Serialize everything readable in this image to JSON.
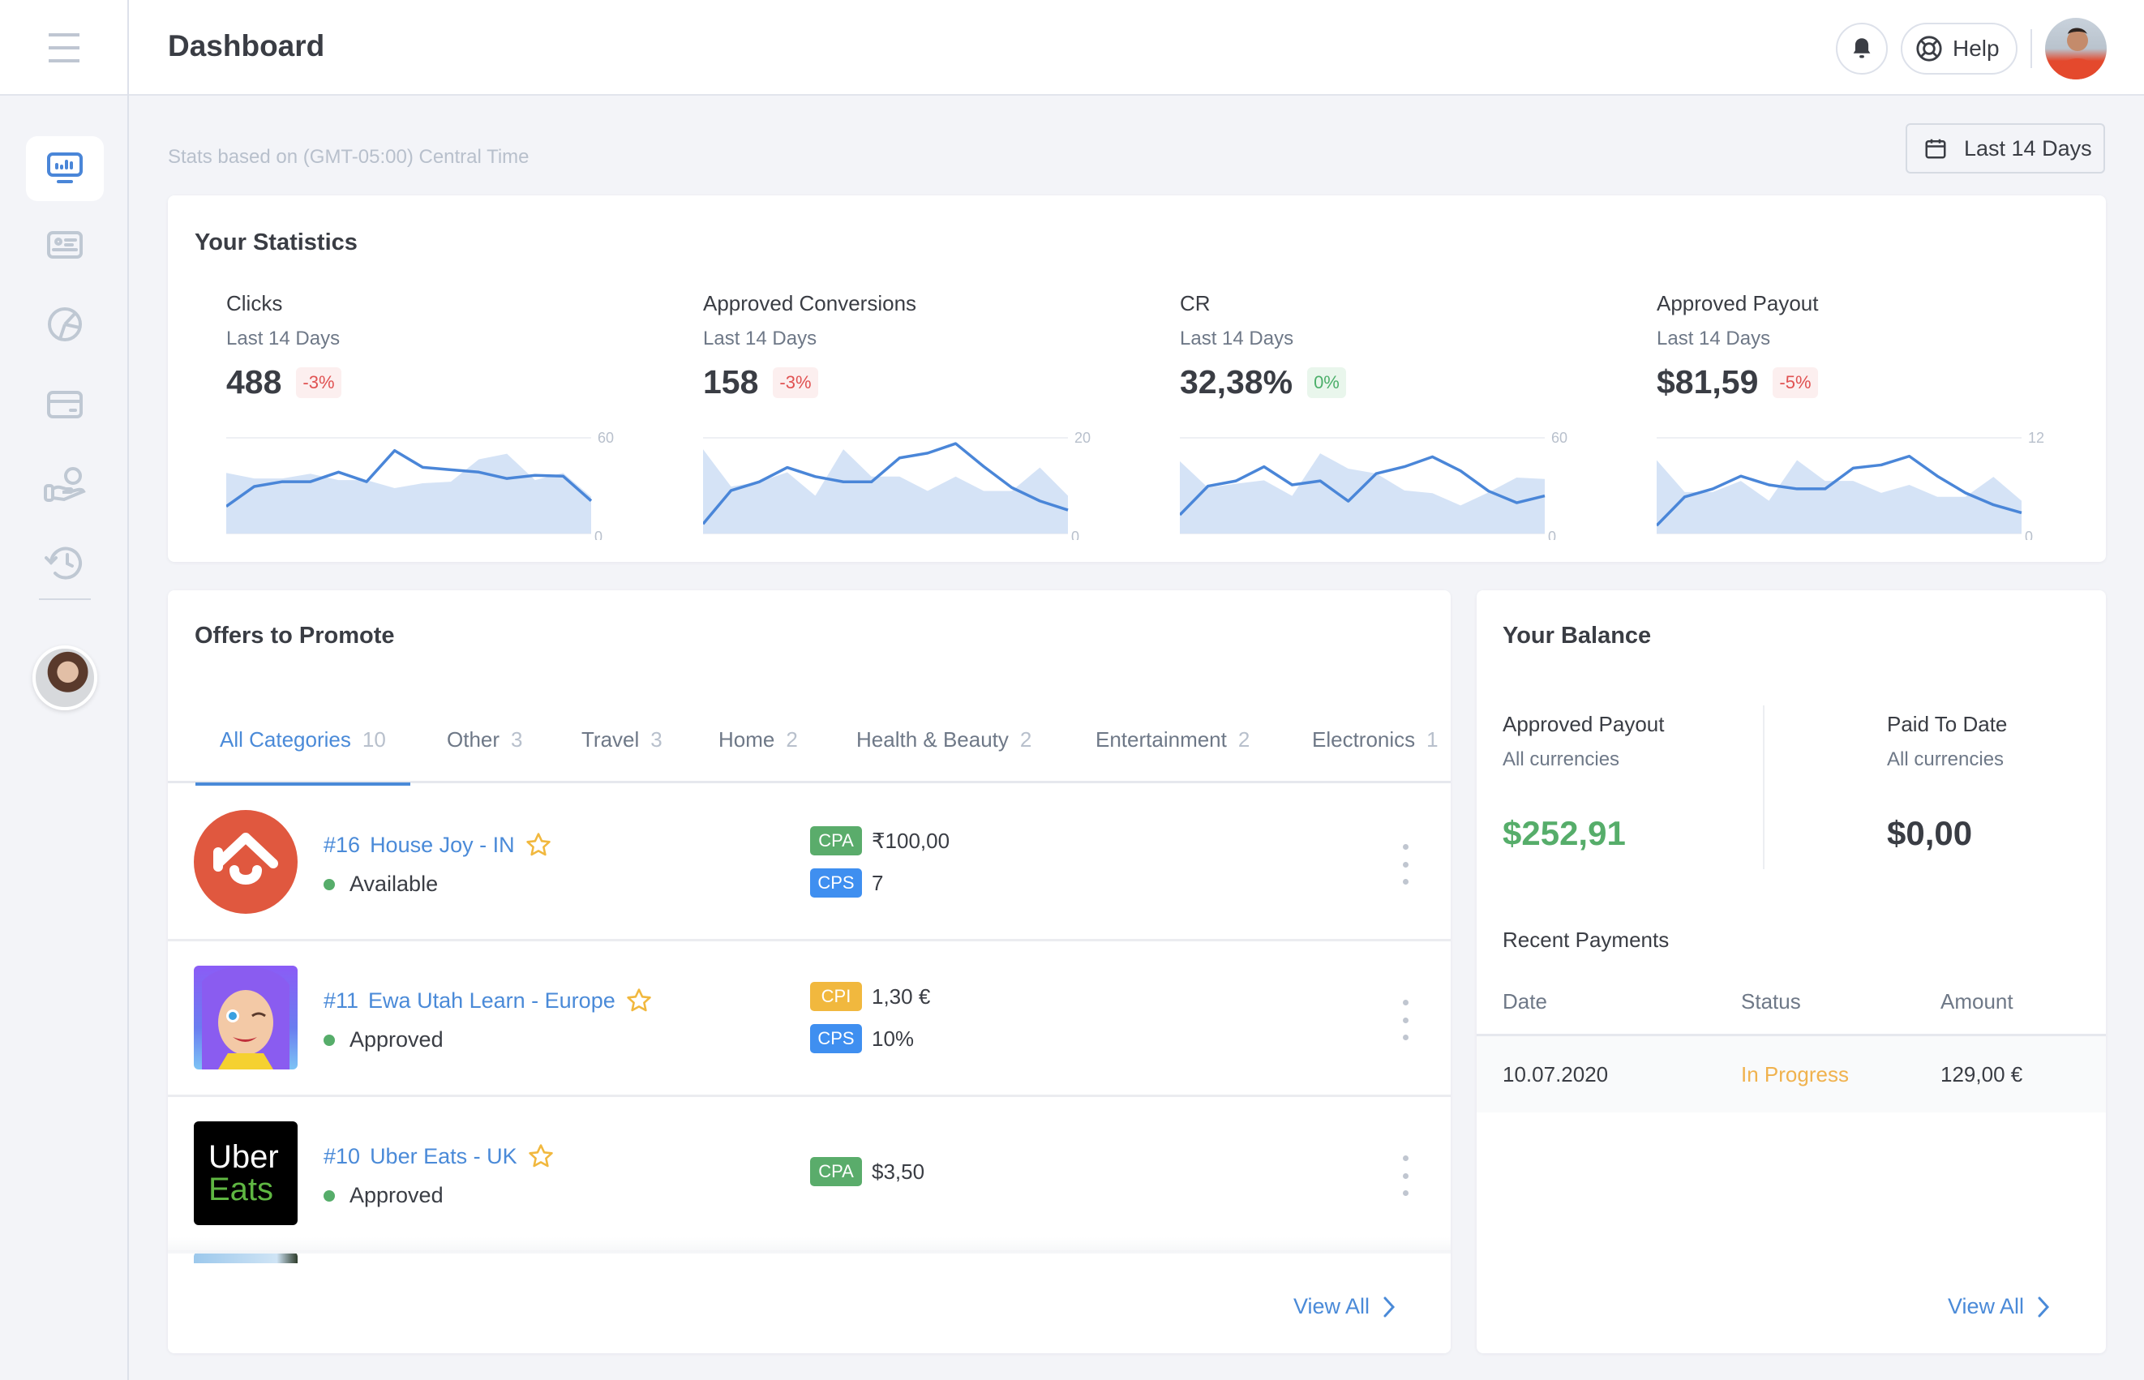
{
  "header": {
    "title": "Dashboard",
    "help_label": "Help"
  },
  "sidebar": {
    "items": [
      {
        "icon": "dashboard-monitor-icon",
        "active": true
      },
      {
        "icon": "id-card-icon",
        "active": false
      },
      {
        "icon": "pie-chart-icon",
        "active": false
      },
      {
        "icon": "credit-card-icon",
        "active": false
      },
      {
        "icon": "hand-coin-icon",
        "active": false
      },
      {
        "icon": "history-icon",
        "active": false
      }
    ]
  },
  "toolbar": {
    "timezone_note": "Stats based on (GMT-05:00) Central Time",
    "date_range": "Last 14 Days"
  },
  "statistics": {
    "title": "Your Statistics",
    "items": [
      {
        "label": "Clicks",
        "period": "Last 14 Days",
        "value": "488",
        "delta": "-3%",
        "delta_type": "neg"
      },
      {
        "label": "Approved Conversions",
        "period": "Last 14 Days",
        "value": "158",
        "delta": "-3%",
        "delta_type": "neg"
      },
      {
        "label": "CR",
        "period": "Last 14 Days",
        "value": "32,38%",
        "delta": "0%",
        "delta_type": "zero"
      },
      {
        "label": "Approved Payout",
        "period": "Last 14 Days",
        "value": "$81,59",
        "delta": "-5%",
        "delta_type": "neg"
      }
    ]
  },
  "chart_data": [
    {
      "type": "line",
      "title": "Clicks",
      "ylim": [
        0,
        60
      ],
      "ytick_labels": [
        "60",
        "0"
      ],
      "series": [
        {
          "name": "current",
          "style": "line",
          "color": "#4a86d8",
          "values": [
            17,
            29.5,
            32.5,
            32.5,
            38.5,
            32.5,
            52,
            41.5,
            40,
            38.5,
            34.5,
            36.5,
            36,
            20.5
          ]
        },
        {
          "name": "previous",
          "style": "area",
          "color": "#d5e3f6",
          "values": [
            38,
            34.5,
            34.5,
            37.5,
            33.5,
            33.5,
            28.5,
            31.5,
            32.5,
            46.5,
            50,
            33.5,
            38,
            23
          ]
        }
      ]
    },
    {
      "type": "line",
      "title": "Approved Conversions",
      "ylim": [
        0,
        20
      ],
      "ytick_labels": [
        "20",
        "0"
      ],
      "series": [
        {
          "name": "current",
          "style": "line",
          "color": "#4a86d8",
          "values": [
            2,
            9,
            10.8,
            13.8,
            11.9,
            10.8,
            10.8,
            15.8,
            16.8,
            18.8,
            14,
            9.6,
            6.8,
            4.9
          ]
        },
        {
          "name": "previous",
          "style": "area",
          "color": "#d5e3f6",
          "values": [
            17.6,
            9.8,
            10.8,
            12.8,
            7.9,
            17.6,
            11.9,
            11.9,
            8.9,
            11.9,
            8.9,
            8.9,
            13.8,
            7.9
          ]
        }
      ]
    },
    {
      "type": "line",
      "title": "CR",
      "ylim": [
        0,
        60
      ],
      "ytick_labels": [
        "60",
        "0"
      ],
      "series": [
        {
          "name": "current",
          "style": "line",
          "color": "#4a86d8",
          "values": [
            11.7,
            29.7,
            33,
            41.9,
            30.5,
            33,
            20.3,
            37.6,
            41.9,
            48.1,
            39.3,
            26.6,
            19.3,
            23.6
          ]
        },
        {
          "name": "previous",
          "style": "area",
          "color": "#d5e3f6",
          "values": [
            45.3,
            28.8,
            31.2,
            33.4,
            23.6,
            50.3,
            40.7,
            37.6,
            27,
            25.3,
            17.6,
            25.8,
            35.1,
            34.2
          ]
        }
      ]
    },
    {
      "type": "line",
      "title": "Approved Payout",
      "ylim": [
        0,
        12
      ],
      "ytick_labels": [
        "12",
        "0"
      ],
      "series": [
        {
          "name": "current",
          "style": "line",
          "color": "#4a86d8",
          "values": [
            1,
            4.6,
            5.6,
            7.2,
            6.1,
            5.6,
            5.6,
            8.2,
            8.6,
            9.7,
            7.2,
            5.1,
            3.6,
            2.6
          ]
        },
        {
          "name": "previous",
          "style": "area",
          "color": "#d5e3f6",
          "values": [
            9.2,
            5.2,
            5.2,
            6.6,
            4.1,
            9.2,
            6.6,
            6.6,
            5.1,
            6.1,
            4.6,
            4.6,
            7.1,
            4.1
          ]
        }
      ]
    }
  ],
  "offers": {
    "title": "Offers to Promote",
    "tabs": [
      {
        "label": "All Categories",
        "count": "10",
        "active": true
      },
      {
        "label": "Other",
        "count": "3"
      },
      {
        "label": "Travel",
        "count": "3"
      },
      {
        "label": "Home",
        "count": "2"
      },
      {
        "label": "Health & Beauty",
        "count": "2"
      },
      {
        "label": "Entertainment",
        "count": "2"
      },
      {
        "label": "Electronics",
        "count": "1"
      }
    ],
    "rows": [
      {
        "id": "#16",
        "name": "House Joy - IN",
        "status": "Available",
        "logo": "house-joy-logo",
        "payouts": [
          {
            "type": "CPA",
            "value": "₹100,00"
          },
          {
            "type": "CPS",
            "value": "7"
          }
        ]
      },
      {
        "id": "#11",
        "name": "Ewa Utah Learn - Europe",
        "status": "Approved",
        "logo": "ewa-logo",
        "payouts": [
          {
            "type": "CPI",
            "value": "1,30 €"
          },
          {
            "type": "CPS",
            "value": "10%"
          }
        ]
      },
      {
        "id": "#10",
        "name": "Uber Eats - UK",
        "status": "Approved",
        "logo": "uber-eats-logo",
        "logo_text": [
          "Uber",
          "Eats"
        ],
        "payouts": [
          {
            "type": "CPA",
            "value": "$3,50"
          }
        ]
      }
    ],
    "view_all": "View All"
  },
  "balance": {
    "title": "Your Balance",
    "approved": {
      "label": "Approved Payout",
      "sub": "All currencies",
      "value": "$252,91"
    },
    "paid": {
      "label": "Paid To Date",
      "sub": "All currencies",
      "value": "$0,00"
    },
    "recent_title": "Recent Payments",
    "columns": [
      "Date",
      "Status",
      "Amount"
    ],
    "payments": [
      {
        "date": "10.07.2020",
        "status": "In Progress",
        "amount": "129,00 €"
      }
    ],
    "view_all": "View All"
  },
  "colors": {
    "accent": "#4a8ad8",
    "positive": "#56ad6a",
    "negative": "#e05252",
    "warning": "#f0b24e"
  }
}
